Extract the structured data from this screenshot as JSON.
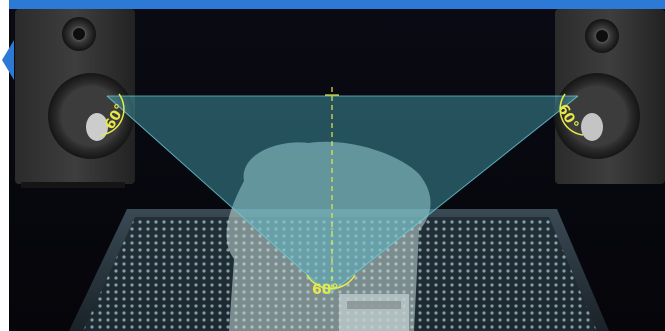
{
  "scene": {
    "angle_left": "60°",
    "angle_right": "60°",
    "angle_bottom": "60°",
    "objects": [
      "left-studio-monitor",
      "right-studio-monitor",
      "mixing-console",
      "listener-head-silhouette",
      "stereo-triangle"
    ]
  },
  "colors": {
    "frame_blue": "#2d7ad6",
    "triangle_fill": "#4fb7c9",
    "annotation_yellow": "#e6e94a",
    "background": "#07070f"
  },
  "icons": {
    "back_tab": "chevron-left-icon"
  }
}
